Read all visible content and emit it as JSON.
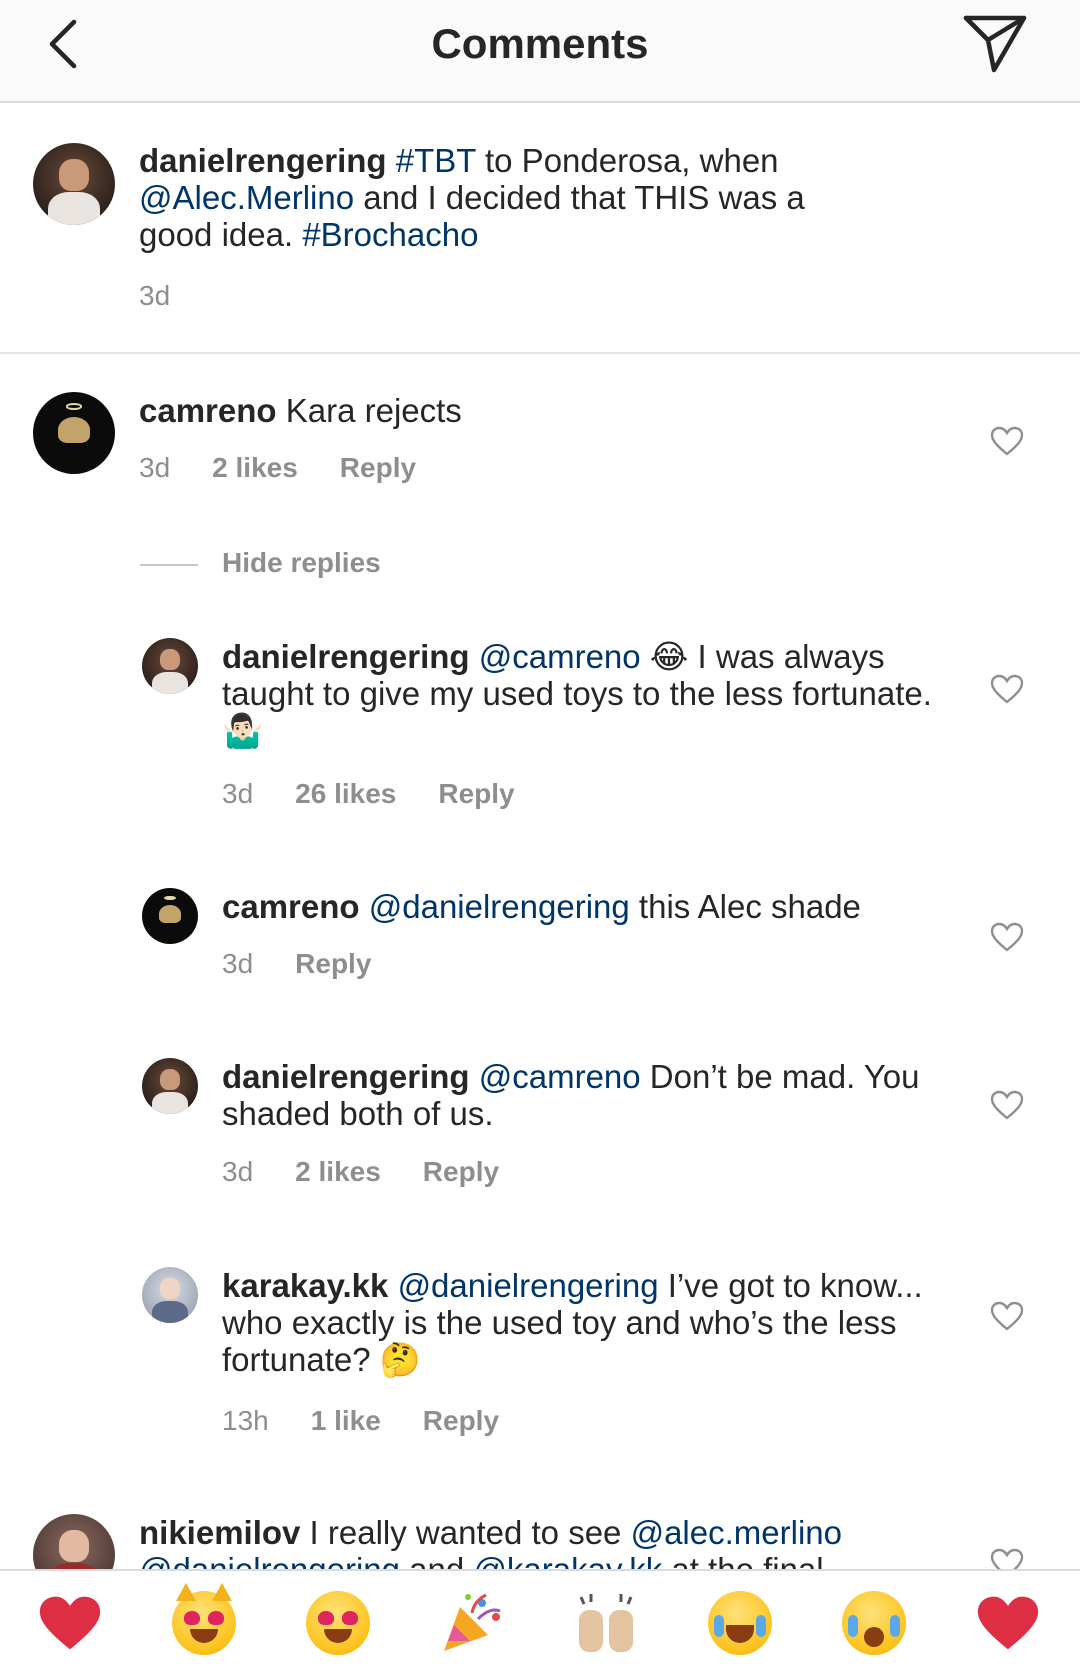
{
  "header": {
    "title": "Comments"
  },
  "caption": {
    "user": "danielrengering",
    "text_parts": [
      " ",
      "#TBT",
      " to Ponderosa, when ",
      "@Alec.Merlino",
      " and I decided that THIS was a good idea. ",
      "#Brochacho"
    ],
    "time": "3d"
  },
  "comments": [
    {
      "user": "camreno",
      "text": " Kara rejects",
      "time": "3d",
      "likes": "2 likes",
      "reply": "Reply"
    }
  ],
  "hide_replies": "Hide replies",
  "replies": [
    {
      "user": "danielrengering",
      "mention": "@camreno",
      "text_a": " 😂 I was always taught to give my used toys to the less fortunate. 🤷🏻‍♂️",
      "time": "3d",
      "likes": "26 likes",
      "reply": "Reply"
    },
    {
      "user": "camreno",
      "mention": "@danielrengering",
      "text_a": " this Alec shade",
      "time": "3d",
      "reply": "Reply"
    },
    {
      "user": "danielrengering",
      "mention": "@camreno",
      "text_a": " Don’t be mad. You shaded both of us.",
      "time": "3d",
      "likes": "2 likes",
      "reply": "Reply"
    },
    {
      "user": "karakay.kk",
      "mention": "@danielrengering",
      "text_a": " I’ve got to know... who exactly is the used toy and who’s the less fortunate? 🤔",
      "time": "13h",
      "likes": "1 like",
      "reply": "Reply"
    }
  ],
  "last_comment": {
    "user": "nikiemilov",
    "text_a": " I really wanted to see ",
    "mention1": "@alec.merlino",
    "line2_a": "@danielrengering",
    "line2_b": " and ",
    "line2_c": "@karakay.kk",
    "line2_d": " at the final"
  },
  "emoji_bar": [
    {
      "icon": "red-heart-emoji"
    },
    {
      "icon": "heart-eyes-cat-emoji"
    },
    {
      "icon": "heart-eyes-emoji"
    },
    {
      "icon": "party-popper-emoji"
    },
    {
      "icon": "raising-hands-emoji"
    },
    {
      "icon": "tears-of-joy-emoji"
    },
    {
      "icon": "loudly-crying-emoji"
    },
    {
      "icon": "red-heart-emoji"
    }
  ]
}
